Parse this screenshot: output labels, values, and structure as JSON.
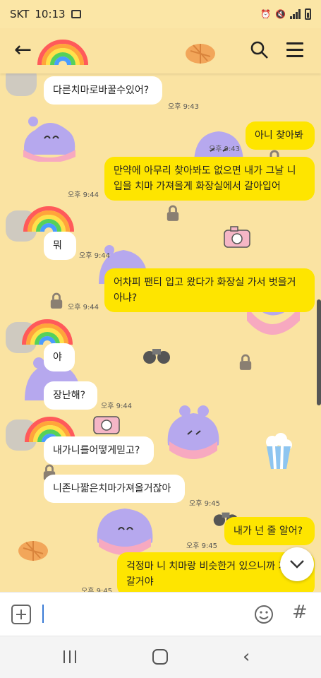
{
  "status": {
    "carrier": "SKT",
    "time": "10:13"
  },
  "header": {
    "back_label": "←"
  },
  "messages": [
    {
      "text": "다른치마로바꿀수있어?",
      "time": "오후 9:43"
    },
    {
      "text": "아니 찾아봐",
      "time": "오후 9:43"
    },
    {
      "text": "만약에 아무리 찾아봐도 없으면 내가 그날 니 입을 치마 가져올게 화장실에서 갈아입어",
      "time": "오후 9:44"
    },
    {
      "text": "뭐",
      "time": "오후 9:44"
    },
    {
      "text": "어차피 팬티 입고 왔다가 화장실 가서 벗을거 아냐?",
      "time": "오후 9:44"
    },
    {
      "text": "야",
      "time": ""
    },
    {
      "text": "장난해?",
      "time": "오후 9:44"
    },
    {
      "text": "내가니를어떻게믿고?",
      "time": ""
    },
    {
      "text": "니존나짧은치마가져올거잖아",
      "time": "오후 9:45"
    },
    {
      "text": "내가 넌 줄 알어?",
      "time": "오후 9:45"
    },
    {
      "text": "걱정마 니 치마랑 비슷한거 있으니까 가져갈거야",
      "time": "오후 9:45"
    }
  ],
  "input": {
    "placeholder": ""
  },
  "input_bar": {
    "hash_label": "#"
  },
  "nav": {
    "back_label": "‹"
  },
  "colors": {
    "background": "#fae3a2",
    "outgoing": "#fee500",
    "incoming": "#ffffff",
    "character": "#b6a8ee"
  },
  "icons": [
    "back-arrow-icon",
    "rainbow-icon",
    "search-icon",
    "menu-icon",
    "plus-icon",
    "emoji-icon",
    "chevron-down-icon",
    "lock-icon",
    "camera-icon",
    "binoculars-icon",
    "popcorn-icon",
    "hat-icon"
  ]
}
